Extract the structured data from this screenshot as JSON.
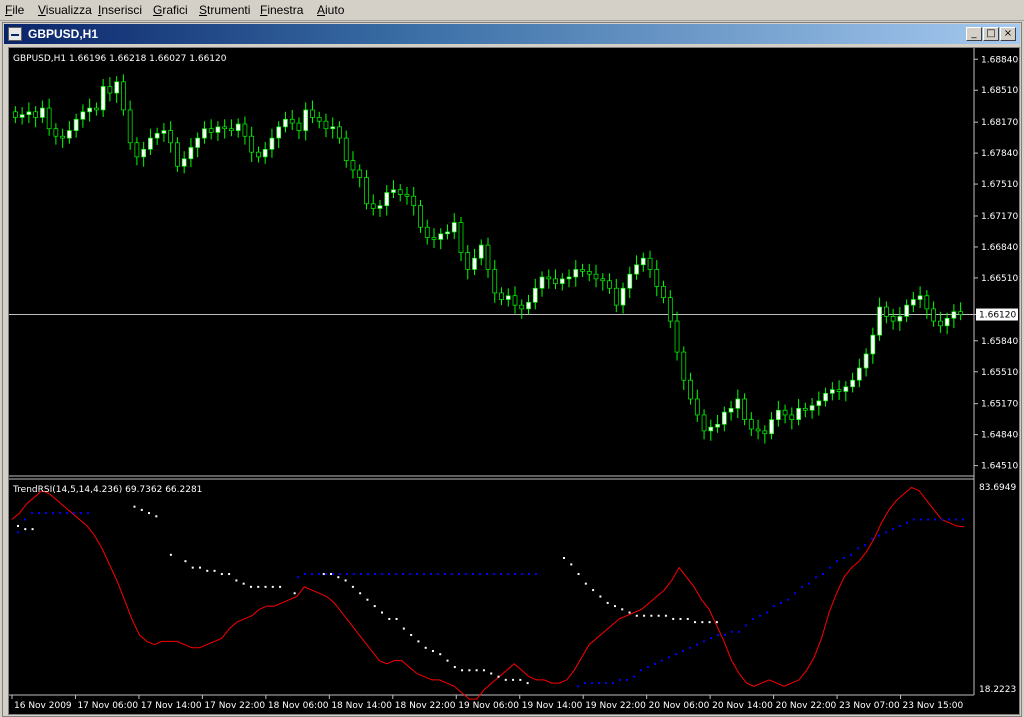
{
  "menu": [
    "File",
    "Visualizza",
    "Inserisci",
    "Grafici",
    "Strumenti",
    "Finestra",
    "Aiuto"
  ],
  "window": {
    "title": "GBPUSD,H1",
    "buttons": {
      "minimize": "_",
      "maximize": "□",
      "close": "×"
    }
  },
  "colors": {
    "background": "#000000",
    "candle_bull": "#ffffff",
    "candle_bear": "#000000",
    "wick": "#00ff00",
    "price_line": "#c0c0c0",
    "rsi_line": "#ff0000",
    "dots_white": "#ffffff",
    "dots_blue": "#0000ff"
  },
  "price_panel": {
    "label": "GBPUSD,H1  1.66196 1.66218 1.66027 1.66120",
    "current_price": "1.66120"
  },
  "indicator_panel": {
    "label": "TrendRSI(14,5,14,4.236) 69.7362 66.2281"
  },
  "chart_data": [
    {
      "type": "candlestick",
      "title": "GBPUSD,H1",
      "y_ticks": [
        "1.68840",
        "1.68510",
        "1.68170",
        "1.67840",
        "1.67510",
        "1.67170",
        "1.66840",
        "1.66510",
        "1.66120",
        "1.65840",
        "1.65510",
        "1.65170",
        "1.64840",
        "1.64510"
      ],
      "x_ticks": [
        "16 Nov 2009",
        "17 Nov 06:00",
        "17 Nov 14:00",
        "17 Nov 22:00",
        "18 Nov 06:00",
        "18 Nov 14:00",
        "18 Nov 22:00",
        "19 Nov 06:00",
        "19 Nov 14:00",
        "19 Nov 22:00",
        "20 Nov 06:00",
        "20 Nov 14:00",
        "20 Nov 22:00",
        "23 Nov 07:00",
        "23 Nov 15:00"
      ],
      "ylim": [
        1.6441,
        1.6896
      ],
      "current_price": 1.6612,
      "close": [
        1.6822,
        1.6825,
        1.6828,
        1.6822,
        1.6832,
        1.681,
        1.6802,
        1.68,
        1.6808,
        1.682,
        1.6828,
        1.6832,
        1.683,
        1.6855,
        1.6848,
        1.686,
        1.683,
        1.6795,
        1.678,
        1.6788,
        1.68,
        1.6805,
        1.6808,
        1.6795,
        1.677,
        1.6778,
        1.679,
        1.68,
        1.681,
        1.6806,
        1.6812,
        1.681,
        1.6808,
        1.6815,
        1.6802,
        1.6785,
        1.678,
        1.6788,
        1.68,
        1.6812,
        1.682,
        1.6816,
        1.6808,
        1.683,
        1.6822,
        1.6818,
        1.681,
        1.6812,
        1.68,
        1.6776,
        1.6766,
        1.6758,
        1.673,
        1.6725,
        1.6728,
        1.6742,
        1.6745,
        1.674,
        1.6738,
        1.6728,
        1.6705,
        1.6694,
        1.6692,
        1.6698,
        1.67,
        1.671,
        1.6678,
        1.666,
        1.6672,
        1.6686,
        1.666,
        1.6635,
        1.6628,
        1.6632,
        1.6622,
        1.6618,
        1.6625,
        1.664,
        1.6652,
        1.665,
        1.6645,
        1.665,
        1.6652,
        1.666,
        1.6658,
        1.6655,
        1.665,
        1.6648,
        1.664,
        1.6622,
        1.664,
        1.6655,
        1.6665,
        1.6672,
        1.666,
        1.6642,
        1.663,
        1.6605,
        1.6572,
        1.6542,
        1.6522,
        1.6505,
        1.6488,
        1.6492,
        1.6495,
        1.6508,
        1.6512,
        1.6522,
        1.65,
        1.649,
        1.6488,
        1.6485,
        1.65,
        1.651,
        1.6505,
        1.65,
        1.6512,
        1.651,
        1.6515,
        1.652,
        1.6528,
        1.6532,
        1.653,
        1.6535,
        1.6542,
        1.6555,
        1.657,
        1.659,
        1.662,
        1.661,
        1.6605,
        1.661,
        1.6622,
        1.6628,
        1.6632,
        1.6618,
        1.6605,
        1.66,
        1.6608,
        1.6615,
        1.6612
      ],
      "open": [
        1.6828,
        1.6822,
        1.6825,
        1.6828,
        1.6822,
        1.6832,
        1.681,
        1.6802,
        1.68,
        1.6808,
        1.682,
        1.6828,
        1.6832,
        1.683,
        1.6855,
        1.6848,
        1.686,
        1.683,
        1.6795,
        1.678,
        1.6788,
        1.68,
        1.6805,
        1.6808,
        1.6795,
        1.677,
        1.6778,
        1.679,
        1.68,
        1.681,
        1.6806,
        1.6812,
        1.681,
        1.6808,
        1.6815,
        1.6802,
        1.6785,
        1.678,
        1.6788,
        1.68,
        1.6812,
        1.682,
        1.6816,
        1.6808,
        1.683,
        1.6822,
        1.6818,
        1.681,
        1.6812,
        1.68,
        1.6776,
        1.6766,
        1.6758,
        1.673,
        1.6725,
        1.6728,
        1.6742,
        1.6745,
        1.674,
        1.6738,
        1.6728,
        1.6705,
        1.6694,
        1.6692,
        1.6698,
        1.67,
        1.671,
        1.6678,
        1.666,
        1.6672,
        1.6686,
        1.666,
        1.6635,
        1.6628,
        1.6632,
        1.6622,
        1.6618,
        1.6625,
        1.664,
        1.6652,
        1.665,
        1.6645,
        1.665,
        1.6652,
        1.666,
        1.6658,
        1.6655,
        1.665,
        1.6648,
        1.664,
        1.6622,
        1.664,
        1.6655,
        1.6665,
        1.6672,
        1.666,
        1.6642,
        1.663,
        1.6605,
        1.6572,
        1.6542,
        1.6522,
        1.6505,
        1.6488,
        1.6492,
        1.6495,
        1.6508,
        1.6512,
        1.6522,
        1.65,
        1.649,
        1.6488,
        1.6485,
        1.65,
        1.651,
        1.6505,
        1.65,
        1.6512,
        1.651,
        1.6515,
        1.652,
        1.6528,
        1.6532,
        1.653,
        1.6535,
        1.6542,
        1.6555,
        1.657,
        1.659,
        1.662,
        1.661,
        1.6605,
        1.661,
        1.6622,
        1.6628,
        1.6632,
        1.6618,
        1.6605,
        1.66,
        1.6608,
        1.6615
      ]
    },
    {
      "type": "line",
      "title": "TrendRSI(14,5,14,4.236) 69.7362 66.2281",
      "y_ticks": [
        "83.6949",
        "18.2223"
      ],
      "ylim": [
        18.2223,
        83.6949
      ],
      "rsi": [
        72,
        74,
        77,
        79,
        81,
        80,
        78,
        76,
        74,
        72,
        70,
        67,
        63,
        58,
        53,
        47,
        41,
        36,
        34,
        33,
        34,
        34,
        34,
        33,
        32,
        32,
        33,
        34,
        35,
        38,
        40,
        41,
        42,
        44,
        45,
        45,
        46,
        47,
        48,
        51,
        50,
        49,
        48,
        46,
        43,
        40,
        37,
        34,
        31,
        28,
        27,
        28,
        28,
        26,
        24,
        23,
        22,
        22,
        21,
        20,
        18,
        16,
        16,
        19,
        21,
        23,
        25,
        27,
        25,
        23,
        22,
        22,
        21,
        21,
        22,
        25,
        29,
        33,
        35,
        37,
        39,
        41,
        42,
        43,
        44,
        46,
        48,
        50,
        53,
        57,
        54,
        51,
        47,
        44,
        39,
        34,
        28,
        24,
        21,
        20,
        21,
        22,
        21,
        20,
        21,
        22,
        25,
        29,
        35,
        43,
        49,
        54,
        57,
        59,
        62,
        66,
        71,
        75,
        78,
        80,
        82,
        81,
        78,
        75,
        72,
        71,
        70,
        69.7
      ],
      "dots_white": [
        [
          0,
          70
        ],
        [
          1,
          69
        ],
        [
          2,
          69
        ],
        [
          16,
          76
        ],
        [
          17,
          75
        ],
        [
          18,
          74
        ],
        [
          19,
          73
        ],
        [
          21,
          61
        ],
        [
          23,
          59
        ],
        [
          24,
          57
        ],
        [
          25,
          57
        ],
        [
          26,
          56
        ],
        [
          27,
          56
        ],
        [
          28,
          55
        ],
        [
          29,
          55
        ],
        [
          30,
          53
        ],
        [
          31,
          52
        ],
        [
          32,
          51
        ],
        [
          33,
          51
        ],
        [
          34,
          51
        ],
        [
          35,
          51
        ],
        [
          36,
          51
        ],
        [
          38,
          49
        ],
        [
          42,
          55
        ],
        [
          43,
          55
        ],
        [
          44,
          54
        ],
        [
          45,
          53
        ],
        [
          46,
          51
        ],
        [
          47,
          49
        ],
        [
          48,
          47
        ],
        [
          49,
          45
        ],
        [
          50,
          43
        ],
        [
          51,
          41
        ],
        [
          52,
          41
        ],
        [
          53,
          38
        ],
        [
          54,
          36
        ],
        [
          55,
          34
        ],
        [
          56,
          32
        ],
        [
          57,
          31
        ],
        [
          58,
          30
        ],
        [
          59,
          28
        ],
        [
          60,
          26
        ],
        [
          61,
          25
        ],
        [
          62,
          25
        ],
        [
          63,
          25
        ],
        [
          64,
          25
        ],
        [
          65,
          24
        ],
        [
          66,
          23
        ],
        [
          67,
          22
        ],
        [
          68,
          22
        ],
        [
          69,
          22
        ],
        [
          70,
          21
        ],
        [
          75,
          60
        ],
        [
          76,
          58
        ],
        [
          77,
          55
        ],
        [
          78,
          52
        ],
        [
          79,
          50
        ],
        [
          80,
          48
        ],
        [
          81,
          46
        ],
        [
          82,
          45
        ],
        [
          83,
          44
        ],
        [
          84,
          43
        ],
        [
          85,
          42
        ],
        [
          86,
          42
        ],
        [
          87,
          42
        ],
        [
          88,
          42
        ],
        [
          89,
          42
        ],
        [
          90,
          41
        ],
        [
          91,
          41
        ],
        [
          92,
          41
        ],
        [
          93,
          40
        ],
        [
          94,
          40
        ],
        [
          95,
          40
        ],
        [
          96,
          40
        ]
      ],
      "dots_blue": [
        [
          0,
          68
        ],
        [
          1,
          72
        ],
        [
          2,
          74
        ],
        [
          3,
          74
        ],
        [
          4,
          74
        ],
        [
          5,
          74
        ],
        [
          6,
          74
        ],
        [
          7,
          74
        ],
        [
          8,
          74
        ],
        [
          9,
          74
        ],
        [
          10,
          74
        ],
        [
          40,
          54
        ],
        [
          41,
          55
        ],
        [
          42,
          55
        ],
        [
          43,
          55
        ],
        [
          44,
          55
        ],
        [
          45,
          55
        ],
        [
          46,
          55
        ],
        [
          47,
          55
        ],
        [
          48,
          55
        ],
        [
          49,
          55
        ],
        [
          50,
          55
        ],
        [
          51,
          55
        ],
        [
          52,
          55
        ],
        [
          53,
          55
        ],
        [
          54,
          55
        ],
        [
          55,
          55
        ],
        [
          56,
          55
        ],
        [
          57,
          55
        ],
        [
          58,
          55
        ],
        [
          59,
          55
        ],
        [
          60,
          55
        ],
        [
          61,
          55
        ],
        [
          62,
          55
        ],
        [
          63,
          55
        ],
        [
          64,
          55
        ],
        [
          65,
          55
        ],
        [
          66,
          55
        ],
        [
          67,
          55
        ],
        [
          68,
          55
        ],
        [
          69,
          55
        ],
        [
          70,
          55
        ],
        [
          71,
          55
        ],
        [
          72,
          55
        ],
        [
          73,
          55
        ],
        [
          74,
          55
        ],
        [
          80,
          20
        ],
        [
          81,
          21
        ],
        [
          82,
          21
        ],
        [
          83,
          21
        ],
        [
          84,
          21
        ],
        [
          85,
          21
        ],
        [
          86,
          22
        ],
        [
          87,
          22
        ],
        [
          88,
          23
        ],
        [
          89,
          25
        ],
        [
          90,
          26
        ],
        [
          91,
          27
        ],
        [
          92,
          28
        ],
        [
          93,
          29
        ],
        [
          94,
          30
        ],
        [
          95,
          31
        ],
        [
          96,
          32
        ],
        [
          97,
          33
        ],
        [
          98,
          34
        ],
        [
          99,
          35
        ],
        [
          100,
          36
        ],
        [
          101,
          36
        ],
        [
          102,
          37
        ],
        [
          103,
          37
        ],
        [
          104,
          39
        ],
        [
          105,
          41
        ],
        [
          106,
          42
        ],
        [
          107,
          43
        ],
        [
          108,
          45
        ],
        [
          109,
          46
        ],
        [
          110,
          47
        ],
        [
          111,
          49
        ],
        [
          112,
          51
        ],
        [
          113,
          52
        ],
        [
          114,
          54
        ],
        [
          115,
          55
        ],
        [
          116,
          57
        ],
        [
          117,
          59
        ],
        [
          118,
          60
        ],
        [
          119,
          61
        ],
        [
          120,
          63
        ],
        [
          121,
          64
        ],
        [
          122,
          66
        ],
        [
          123,
          67
        ],
        [
          124,
          68
        ],
        [
          125,
          69
        ],
        [
          126,
          70
        ],
        [
          127,
          71
        ],
        [
          128,
          72
        ],
        [
          129,
          72
        ],
        [
          130,
          72
        ],
        [
          131,
          72
        ],
        [
          132,
          72
        ],
        [
          133,
          72
        ],
        [
          134,
          72
        ],
        [
          135,
          72
        ]
      ]
    }
  ]
}
